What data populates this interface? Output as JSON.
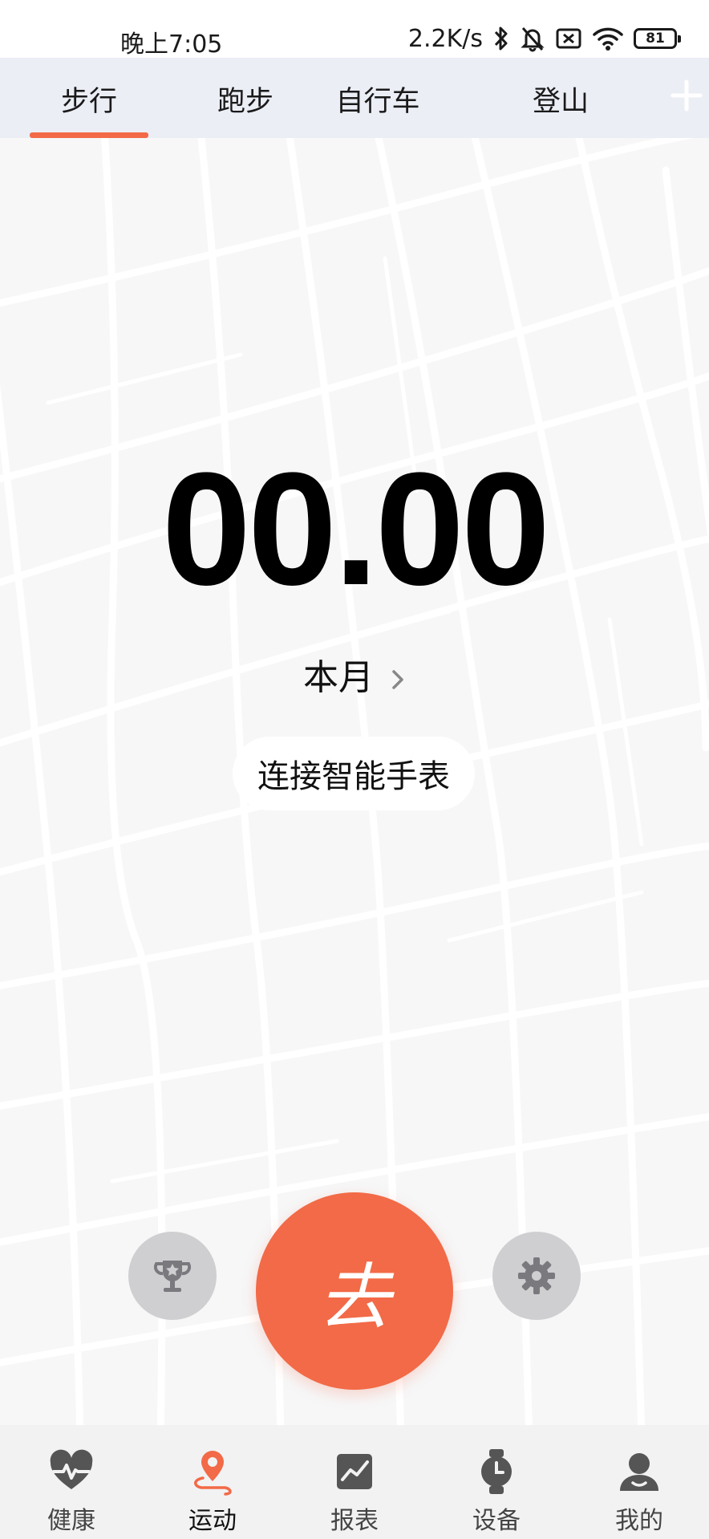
{
  "status_bar": {
    "time": "晚上7:05",
    "net_speed": "2.2K/s",
    "battery": "81",
    "icons": [
      "bluetooth-icon",
      "mute-icon",
      "sim-off-icon",
      "wifi-icon",
      "battery-icon"
    ]
  },
  "tabs": {
    "items": [
      "步行",
      "跑步",
      "自行车",
      "登山"
    ],
    "active_index": 0,
    "add_icon": "plus-icon"
  },
  "main": {
    "value": "00.00",
    "period": "本月",
    "connect_label": "连接智能手表"
  },
  "actions": {
    "go_label": "去",
    "left_icon": "trophy-icon",
    "right_icon": "gear-icon"
  },
  "bottom_nav": {
    "items": [
      {
        "label": "健康",
        "icon": "heart-pulse-icon"
      },
      {
        "label": "运动",
        "icon": "location-pin-icon"
      },
      {
        "label": "报表",
        "icon": "chart-icon"
      },
      {
        "label": "设备",
        "icon": "watch-icon"
      },
      {
        "label": "我的",
        "icon": "user-icon"
      }
    ],
    "active_index": 1
  },
  "colors": {
    "accent": "#f26a47",
    "tab_bg": "#eceef6",
    "map_bg": "#f7f7f8",
    "nav_bg": "#f2f2f3",
    "icon_gray": "#555555"
  }
}
